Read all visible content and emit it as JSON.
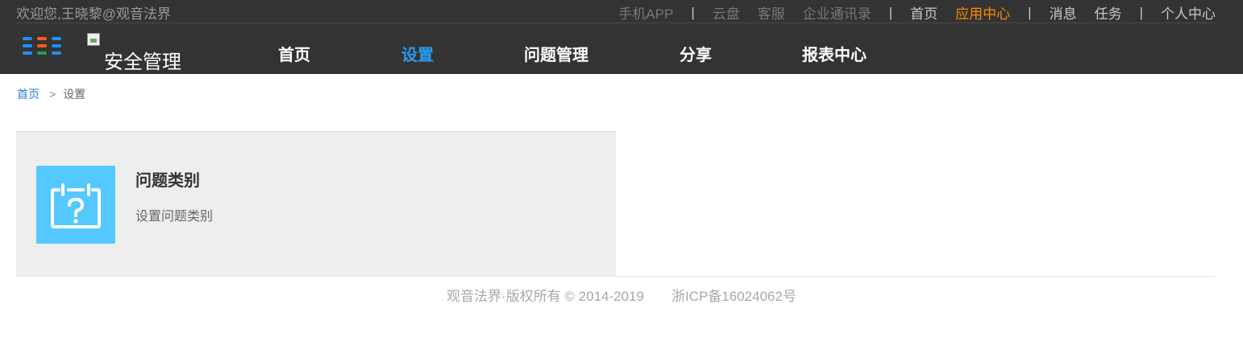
{
  "header": {
    "welcome": "欢迎您,王晓黎@观音法界",
    "top_links": [
      {
        "label": "手机APP",
        "style": "dim"
      },
      {
        "label": "|",
        "style": "sep"
      },
      {
        "label": "云盘",
        "style": "dim"
      },
      {
        "label": "客服",
        "style": "dim"
      },
      {
        "label": "企业通讯录",
        "style": "dim"
      },
      {
        "label": "|",
        "style": "sep"
      },
      {
        "label": "首页",
        "style": "light"
      },
      {
        "label": "应用中心",
        "style": "active"
      },
      {
        "label": "|",
        "style": "sep"
      },
      {
        "label": "消息",
        "style": "light"
      },
      {
        "label": "任务",
        "style": "light"
      },
      {
        "label": "|",
        "style": "sep"
      },
      {
        "label": "个人中心",
        "style": "light"
      }
    ],
    "app_grid_icon": "grid-icon",
    "logo_alt": "安全管理",
    "nav": [
      {
        "label": "首页",
        "active": false
      },
      {
        "label": "设置",
        "active": true
      },
      {
        "label": "问题管理",
        "active": false
      },
      {
        "label": "分享",
        "active": false
      },
      {
        "label": "报表中心",
        "active": false
      }
    ]
  },
  "breadcrumb": {
    "home": "首页",
    "separator": ">",
    "current": "设置"
  },
  "card": {
    "icon": "calendar-question-icon",
    "title": "问题类别",
    "description": "设置问题类别"
  },
  "footer": {
    "copyright": "观音法界·版权所有 © 2014-2019",
    "icp": "浙ICP备16024062号"
  },
  "colors": {
    "header_bg": "#333333",
    "nav_active": "#2b9cf0",
    "top_active": "#ff8a00",
    "card_bg": "#eeeeee",
    "card_icon_bg": "#55c8ff"
  }
}
